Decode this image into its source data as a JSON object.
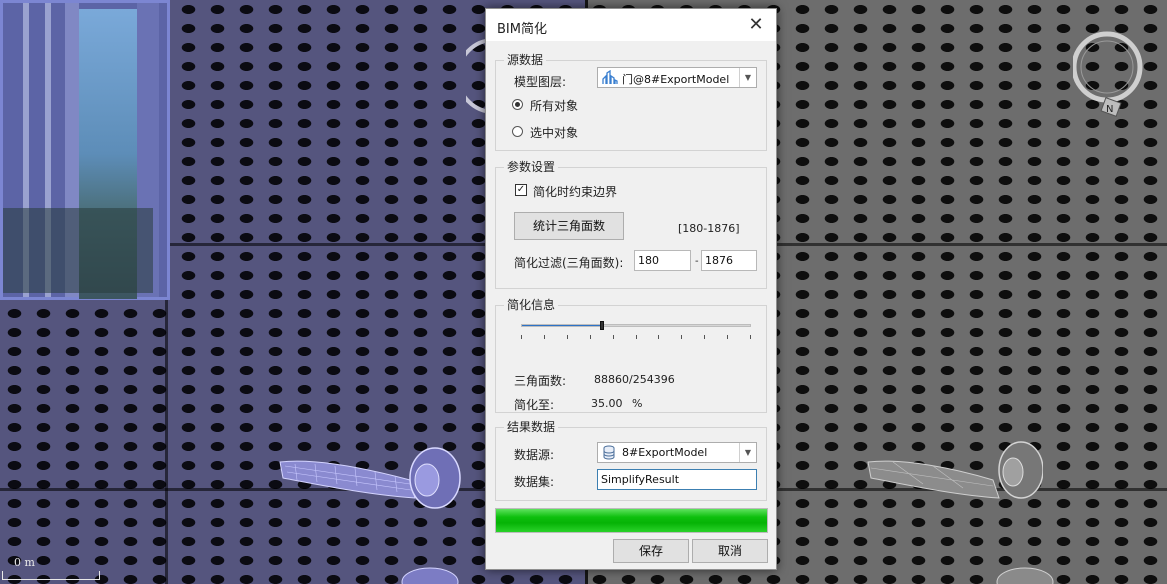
{
  "dialog": {
    "title": "BIM简化",
    "close_icon": "close-icon"
  },
  "source": {
    "legend": "源数据",
    "layer_label": "模型图层:",
    "layer_value": "门@8#ExportModel",
    "layer_icon": "model-layer-icon",
    "radio_all": "所有对象",
    "radio_selected": "选中对象",
    "selected_option": "所有对象"
  },
  "params": {
    "legend": "参数设置",
    "constrain_label": "简化时约束边界",
    "constrain_checked": true,
    "count_button": "统计三角面数",
    "range_text": "[180-1876]",
    "filter_label": "简化过滤(三角面数):",
    "filter_min": "180",
    "filter_sep": "-",
    "filter_max": "1876"
  },
  "info": {
    "legend": "简化信息",
    "slider_value_fraction": 0.35,
    "triangles_label": "三角面数:",
    "triangles_value": "88860/254396",
    "simplify_label": "简化至:",
    "simplify_value": "35.00",
    "simplify_unit": "%"
  },
  "result": {
    "legend": "结果数据",
    "datasource_label": "数据源:",
    "datasource_value": "8#ExportModel",
    "datasource_icon": "database-icon",
    "dataset_label": "数据集:",
    "dataset_value": "SimplifyResult"
  },
  "progress": {
    "value": 1.0,
    "color": "#0ec00e"
  },
  "footer": {
    "save": "保存",
    "cancel": "取消"
  },
  "scene": {
    "scale_label": "0 m",
    "compass_letter": "N"
  },
  "colors": {
    "accent": "#2c72c7",
    "dialog_bg": "#f0f0f0"
  }
}
